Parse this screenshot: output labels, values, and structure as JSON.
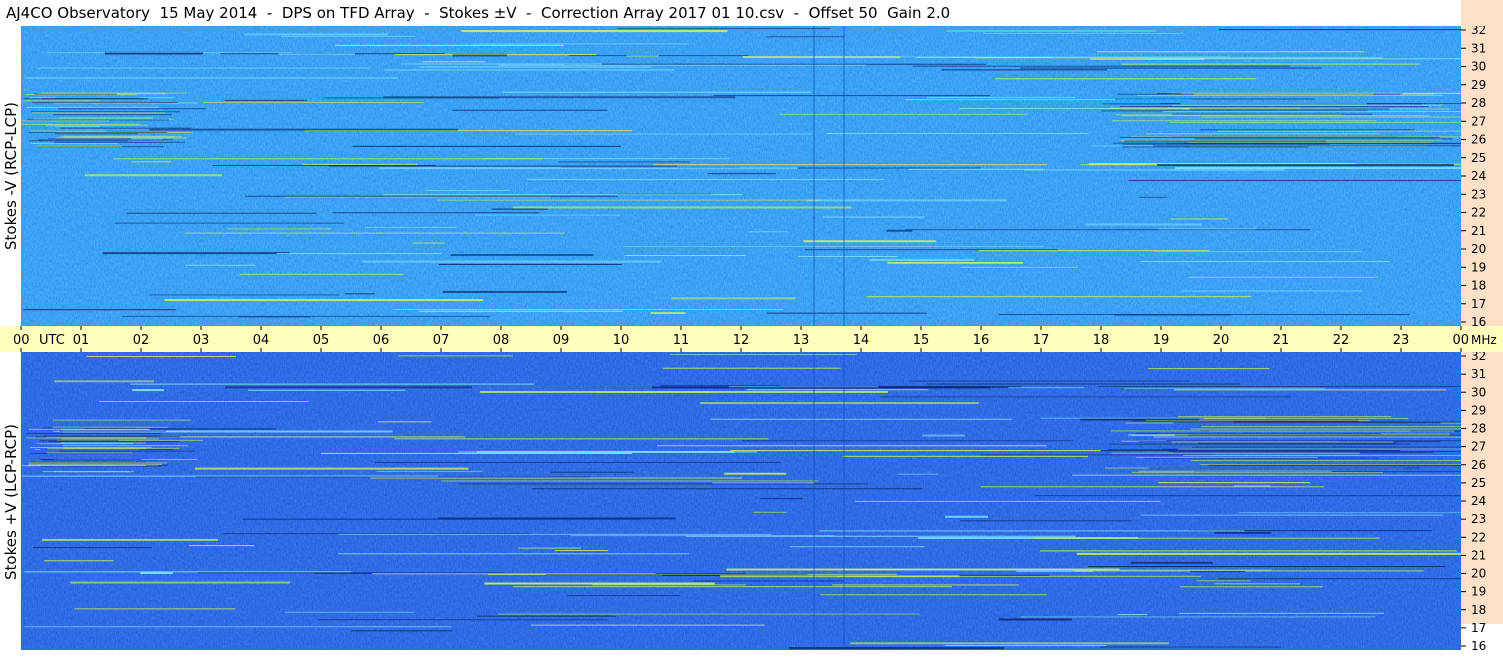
{
  "title": "AJ4CO Observatory  15 May 2014  -  DPS on TFD Array  -  Stokes ±V  -  Correction Array 2017 01 10.csv  -  Offset 50  Gain 2.0",
  "colors": {
    "freq_axis_bg": "#fde0c8",
    "time_axis_bg": "#ffffc0",
    "top_base": "#1a8cf0",
    "bottom_base": "#1a55dd",
    "hot_trace": "#c6f060",
    "dark_trace": "#0c2a70"
  },
  "chart_data": [
    {
      "type": "heatmap",
      "name": "stokes-minus-v",
      "ylabel": "Stokes -V (RCP-LCP)",
      "y_ticks": [
        "32",
        "31",
        "30",
        "29",
        "28",
        "27",
        "26",
        "25",
        "24",
        "23",
        "22",
        "21",
        "20",
        "19",
        "18",
        "17",
        "16"
      ],
      "ylim": [
        16,
        32
      ]
    },
    {
      "type": "heatmap",
      "name": "stokes-plus-v",
      "ylabel": "Stokes +V (LCP-RCP)",
      "y_ticks": [
        "32",
        "31",
        "30",
        "29",
        "28",
        "27",
        "26",
        "25",
        "24",
        "23",
        "22",
        "21",
        "20",
        "19",
        "18",
        "17",
        "16"
      ],
      "ylim": [
        16,
        32
      ]
    }
  ],
  "time_axis": {
    "unit": "UTC",
    "freq_unit": "MHz",
    "labels": [
      "00",
      "01",
      "02",
      "03",
      "04",
      "05",
      "06",
      "07",
      "08",
      "09",
      "10",
      "11",
      "12",
      "13",
      "14",
      "15",
      "16",
      "17",
      "18",
      "19",
      "20",
      "21",
      "22",
      "23",
      "00"
    ],
    "xlim": [
      0,
      24
    ]
  }
}
